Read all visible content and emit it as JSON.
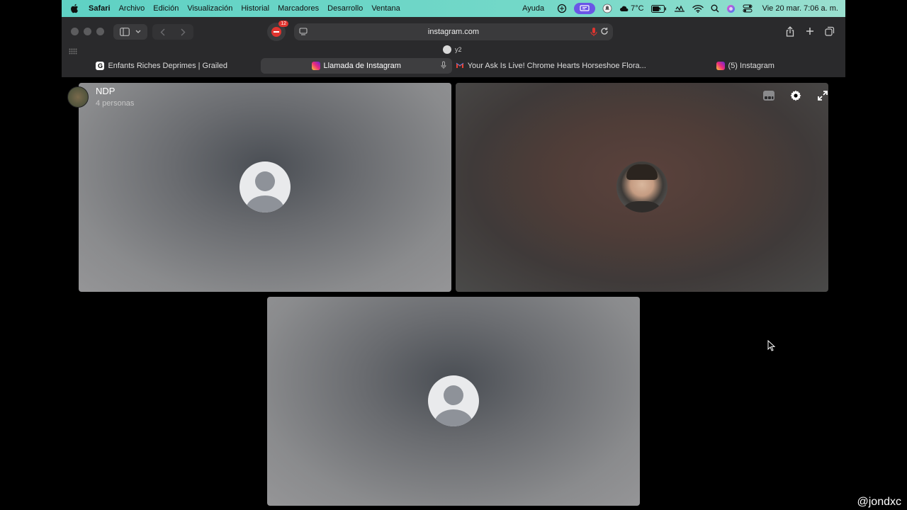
{
  "menubar": {
    "app": "Safari",
    "items": [
      "Archivo",
      "Edición",
      "Visualización",
      "Historial",
      "Marcadores",
      "Desarrollo",
      "Ventana"
    ],
    "help": "Ayuda",
    "weather": "7°C",
    "clock": "Vie 20 mar.  7:06 a. m."
  },
  "toolbar": {
    "url": "instagram.com",
    "extension_badge": "12",
    "profile": "y2"
  },
  "tabs": [
    {
      "label": "Enfants Riches Deprimes | Grailed",
      "favicon": "G"
    },
    {
      "label": "Llamada de Instagram",
      "favicon": "instagram"
    },
    {
      "label": "Your Ask Is Live! Chrome Hearts Horseshoe Flora...",
      "favicon": "gmail"
    },
    {
      "label": "(5) Instagram",
      "favicon": "instagram"
    }
  ],
  "call": {
    "group_name": "NDP",
    "participants_label": "4 personas"
  },
  "watermark": "@jondxc",
  "colors": {
    "menubar": "#6fd6c7",
    "toolbar": "#2a2a2c",
    "accent_purple": "#6a56e6",
    "badge_red": "#e0342f"
  }
}
